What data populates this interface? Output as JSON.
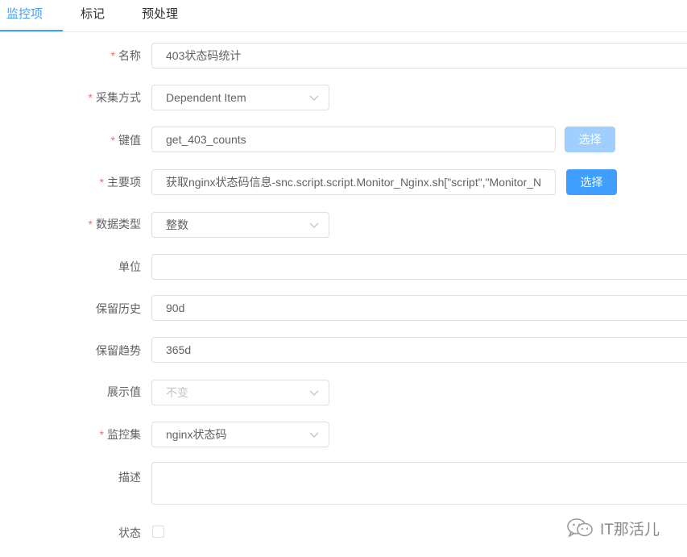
{
  "tabs": [
    {
      "label": "监控项",
      "active": true
    },
    {
      "label": "标记",
      "active": false
    },
    {
      "label": "预处理",
      "active": false
    }
  ],
  "form": {
    "required_mark": "*",
    "name": {
      "label": "名称",
      "value": "403状态码统计"
    },
    "collect_method": {
      "label": "采集方式",
      "value": "Dependent Item"
    },
    "key": {
      "label": "键值",
      "value": "get_403_counts",
      "button": "选择"
    },
    "master_item": {
      "label": "主要项",
      "value": "获取nginx状态码信息-snc.script.script.Monitor_Nginx.sh[\"script\",\"Monitor_N",
      "button": "选择"
    },
    "data_type": {
      "label": "数据类型",
      "value": "整数"
    },
    "unit": {
      "label": "单位",
      "value": ""
    },
    "history": {
      "label": "保留历史",
      "value": "90d"
    },
    "trend": {
      "label": "保留趋势",
      "value": "365d"
    },
    "display_value": {
      "label": "展示值",
      "placeholder": "不变"
    },
    "monitor_set": {
      "label": "监控集",
      "value": "nginx状态码"
    },
    "description": {
      "label": "描述",
      "value": ""
    },
    "status": {
      "label": "状态",
      "checked": false
    }
  },
  "watermark": {
    "text": "IT那活儿",
    "icon": "wechat-icon"
  },
  "colors": {
    "accent": "#409eff",
    "accent_disabled": "#a0cfff",
    "required": "#f56c6c",
    "border": "#dcdfe6"
  }
}
